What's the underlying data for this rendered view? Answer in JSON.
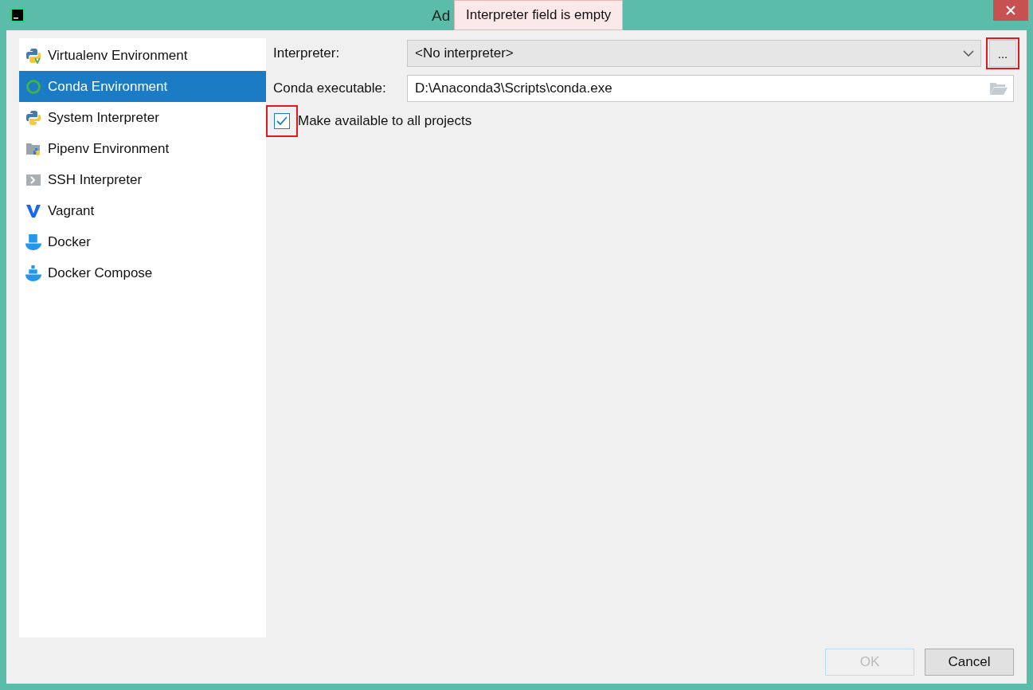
{
  "window": {
    "title": "Ad"
  },
  "tooltip": "Interpreter field is empty",
  "sidebar": {
    "items": [
      {
        "label": "Virtualenv Environment",
        "kind": "virtualenv",
        "selected": false
      },
      {
        "label": "Conda Environment",
        "kind": "conda",
        "selected": true
      },
      {
        "label": "System Interpreter",
        "kind": "python",
        "selected": false
      },
      {
        "label": "Pipenv Environment",
        "kind": "pipenv",
        "selected": false
      },
      {
        "label": "SSH Interpreter",
        "kind": "ssh",
        "selected": false
      },
      {
        "label": "Vagrant",
        "kind": "vagrant",
        "selected": false
      },
      {
        "label": "Docker",
        "kind": "docker",
        "selected": false
      },
      {
        "label": "Docker Compose",
        "kind": "compose",
        "selected": false
      }
    ]
  },
  "interpreter": {
    "label": "Interpreter:",
    "value": "<No interpreter>",
    "browse_button": "...",
    "browse_highlighted": true
  },
  "conda_executable": {
    "label": "Conda executable:",
    "value": "D:\\Anaconda3\\Scripts\\conda.exe"
  },
  "make_available": {
    "label": "Make available to all projects",
    "checked": true,
    "highlighted": true
  },
  "buttons": [
    {
      "label": "OK",
      "disabled": true
    },
    {
      "label": "Cancel",
      "disabled": false
    }
  ]
}
